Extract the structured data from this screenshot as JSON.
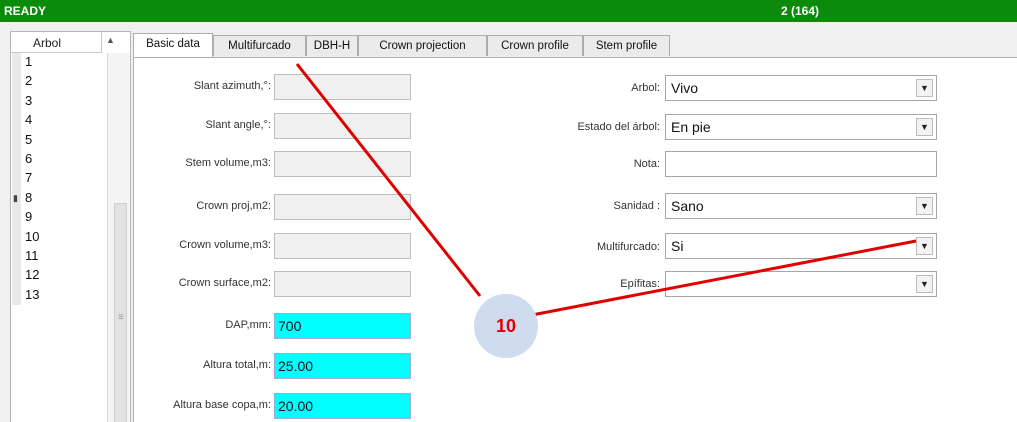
{
  "statusbar": {
    "state": "READY",
    "record": "2 (164)"
  },
  "tree_list": {
    "header": "Arbol",
    "rows": [
      "1",
      "2",
      "3",
      "4",
      "5",
      "6",
      "7",
      "8",
      "9",
      "10",
      "11",
      "12",
      "13"
    ]
  },
  "tabs": [
    "Basic data",
    "Multifurcado",
    "DBH-H",
    "Crown projection",
    "Crown profile",
    "Stem profile"
  ],
  "left_fields": [
    {
      "label": "Slant azimuth,°:",
      "value": ""
    },
    {
      "label": "Slant angle,°:",
      "value": ""
    },
    {
      "label": "Stem volume,m3:",
      "value": ""
    },
    {
      "label": "Crown proj,m2:",
      "value": ""
    },
    {
      "label": "Crown volume,m3:",
      "value": ""
    },
    {
      "label": "Crown surface,m2:",
      "value": ""
    },
    {
      "label": "DAP,mm:",
      "value": "700"
    },
    {
      "label": "Altura total,m:",
      "value": "25.00"
    },
    {
      "label": "Altura base copa,m:",
      "value": "20.00"
    }
  ],
  "right_fields": [
    {
      "label": "Arbol:",
      "value": "Vivo"
    },
    {
      "label": "Estado del árbol:",
      "value": "En pie"
    },
    {
      "label": "Nota:",
      "value": ""
    },
    {
      "label": "Sanidad :",
      "value": "Sano"
    },
    {
      "label": "Multifurcado:",
      "value": "Si"
    },
    {
      "label": "Epífitas:",
      "value": ""
    }
  ],
  "annotation": {
    "number": "10",
    "color": "#e00000"
  }
}
